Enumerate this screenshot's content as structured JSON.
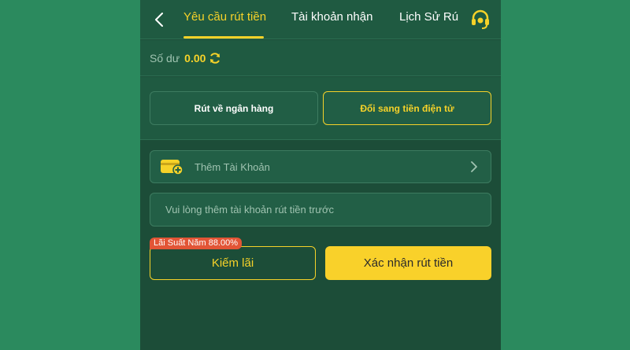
{
  "header": {
    "tabs": [
      {
        "label": "Yêu cầu rút tiền",
        "active": true
      },
      {
        "label": "Tài khoản nhận",
        "active": false
      },
      {
        "label": "Lịch Sử Rú",
        "active": false
      }
    ],
    "back_icon": "chevron-left-icon",
    "support_icon": "headset-icon"
  },
  "balance": {
    "label": "Số dư",
    "value": "0.00",
    "refresh_icon": "refresh-icon"
  },
  "methods": {
    "bank_label": "Rút về ngân hàng",
    "crypto_label": "Đổi sang tiền điện tử",
    "selected": "crypto"
  },
  "form": {
    "add_account_label": "Thêm Tài Khoản",
    "add_account_icon": "wallet-add-icon",
    "info_text": "Vui lòng thêm tài khoản rút tiền trước"
  },
  "actions": {
    "earn_label": "Kiếm lãi",
    "rate_badge": "Lãi Suất Năm 88.00%",
    "confirm_label": "Xác nhận rút tiền"
  },
  "colors": {
    "page_bg": "#2b8a5e",
    "panel_bg": "#1c4d38",
    "accent": "#f6d229",
    "badge": "#e25536"
  }
}
